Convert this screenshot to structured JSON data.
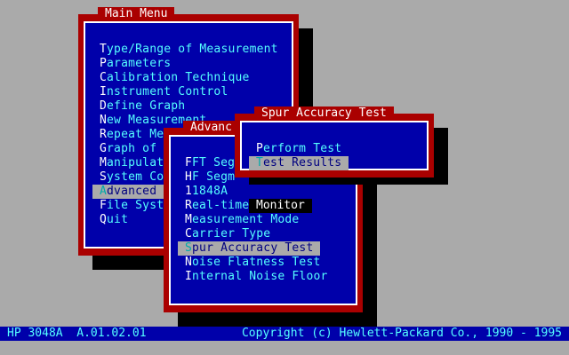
{
  "main_menu": {
    "title": "Main Menu",
    "items": [
      {
        "hotkey": "T",
        "rest": "ype/Range of Measurement"
      },
      {
        "hotkey": "P",
        "rest": "arameters"
      },
      {
        "hotkey": "C",
        "rest": "alibration Technique"
      },
      {
        "hotkey": "I",
        "rest": "nstrument Control"
      },
      {
        "hotkey": "D",
        "rest": "efine Graph"
      },
      {
        "hotkey": "N",
        "rest": "ew Measurement"
      },
      {
        "hotkey": "R",
        "rest": "epeat Me"
      },
      {
        "hotkey": "G",
        "rest": "raph of"
      },
      {
        "hotkey": "M",
        "rest": "anipulat"
      },
      {
        "hotkey": "S",
        "rest": "ystem Co"
      },
      {
        "hotkey": "A",
        "rest": "dvanced"
      },
      {
        "hotkey": "F",
        "rest": "ile Syst"
      },
      {
        "hotkey": "Q",
        "rest": "uit"
      }
    ]
  },
  "advanced_menu": {
    "title": "Advanc",
    "items": [
      {
        "hotkey": "F",
        "rest": "FT Seg"
      },
      {
        "hotkey": "H",
        "rest": "F Segm"
      },
      {
        "hotkey": "1",
        "rest": "1848A"
      },
      {
        "hotkey": "R",
        "rest": "eal-time"
      },
      {
        "hotkey": "M",
        "rest": "easurement Mode"
      },
      {
        "hotkey": "C",
        "rest": "arrier Type"
      },
      {
        "hotkey": "S",
        "rest": "pur Accuracy Test"
      },
      {
        "hotkey": "N",
        "rest": "oise Flatness Test"
      },
      {
        "hotkey": "I",
        "rest": "nternal Noise Floor"
      }
    ],
    "spill_text": "Monitor"
  },
  "spur_menu": {
    "title": "Spur Accuracy Test",
    "items": [
      {
        "hotkey": "P",
        "rest": "erform Test"
      },
      {
        "hotkey": "T",
        "rest": "est Results"
      }
    ]
  },
  "status_bar": {
    "left": "HP 3048A  A.01.02.01",
    "right": "Copyright (c) Hewlett-Packard Co., 1990 - 1995"
  },
  "colors": {
    "desktop": "#aaaaaa",
    "window_frame": "#aa0000",
    "window_body": "#0000aa",
    "menu_text": "#55ffff",
    "hotkey": "#ffffff",
    "selection": "#aaaaaa"
  }
}
